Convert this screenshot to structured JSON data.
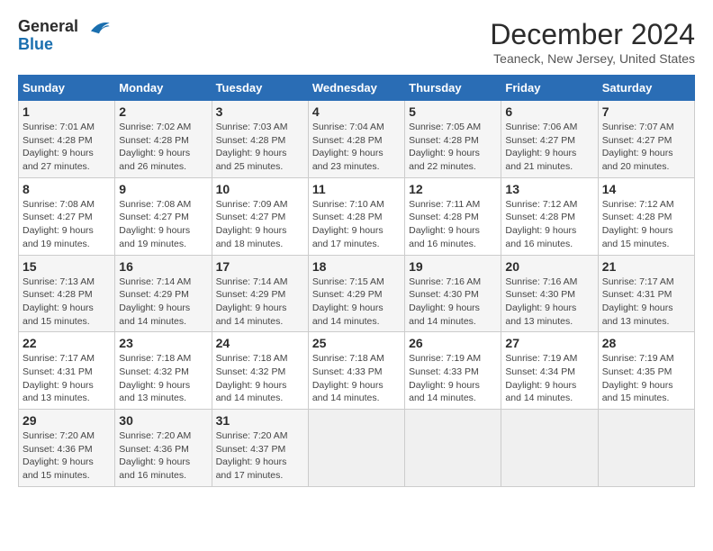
{
  "header": {
    "logo_line1": "General",
    "logo_line2": "Blue",
    "month": "December 2024",
    "location": "Teaneck, New Jersey, United States"
  },
  "days_of_week": [
    "Sunday",
    "Monday",
    "Tuesday",
    "Wednesday",
    "Thursday",
    "Friday",
    "Saturday"
  ],
  "weeks": [
    [
      {
        "day": "1",
        "info": "Sunrise: 7:01 AM\nSunset: 4:28 PM\nDaylight: 9 hours\nand 27 minutes."
      },
      {
        "day": "2",
        "info": "Sunrise: 7:02 AM\nSunset: 4:28 PM\nDaylight: 9 hours\nand 26 minutes."
      },
      {
        "day": "3",
        "info": "Sunrise: 7:03 AM\nSunset: 4:28 PM\nDaylight: 9 hours\nand 25 minutes."
      },
      {
        "day": "4",
        "info": "Sunrise: 7:04 AM\nSunset: 4:28 PM\nDaylight: 9 hours\nand 23 minutes."
      },
      {
        "day": "5",
        "info": "Sunrise: 7:05 AM\nSunset: 4:28 PM\nDaylight: 9 hours\nand 22 minutes."
      },
      {
        "day": "6",
        "info": "Sunrise: 7:06 AM\nSunset: 4:27 PM\nDaylight: 9 hours\nand 21 minutes."
      },
      {
        "day": "7",
        "info": "Sunrise: 7:07 AM\nSunset: 4:27 PM\nDaylight: 9 hours\nand 20 minutes."
      }
    ],
    [
      {
        "day": "8",
        "info": "Sunrise: 7:08 AM\nSunset: 4:27 PM\nDaylight: 9 hours\nand 19 minutes."
      },
      {
        "day": "9",
        "info": "Sunrise: 7:08 AM\nSunset: 4:27 PM\nDaylight: 9 hours\nand 19 minutes."
      },
      {
        "day": "10",
        "info": "Sunrise: 7:09 AM\nSunset: 4:27 PM\nDaylight: 9 hours\nand 18 minutes."
      },
      {
        "day": "11",
        "info": "Sunrise: 7:10 AM\nSunset: 4:28 PM\nDaylight: 9 hours\nand 17 minutes."
      },
      {
        "day": "12",
        "info": "Sunrise: 7:11 AM\nSunset: 4:28 PM\nDaylight: 9 hours\nand 16 minutes."
      },
      {
        "day": "13",
        "info": "Sunrise: 7:12 AM\nSunset: 4:28 PM\nDaylight: 9 hours\nand 16 minutes."
      },
      {
        "day": "14",
        "info": "Sunrise: 7:12 AM\nSunset: 4:28 PM\nDaylight: 9 hours\nand 15 minutes."
      }
    ],
    [
      {
        "day": "15",
        "info": "Sunrise: 7:13 AM\nSunset: 4:28 PM\nDaylight: 9 hours\nand 15 minutes."
      },
      {
        "day": "16",
        "info": "Sunrise: 7:14 AM\nSunset: 4:29 PM\nDaylight: 9 hours\nand 14 minutes."
      },
      {
        "day": "17",
        "info": "Sunrise: 7:14 AM\nSunset: 4:29 PM\nDaylight: 9 hours\nand 14 minutes."
      },
      {
        "day": "18",
        "info": "Sunrise: 7:15 AM\nSunset: 4:29 PM\nDaylight: 9 hours\nand 14 minutes."
      },
      {
        "day": "19",
        "info": "Sunrise: 7:16 AM\nSunset: 4:30 PM\nDaylight: 9 hours\nand 14 minutes."
      },
      {
        "day": "20",
        "info": "Sunrise: 7:16 AM\nSunset: 4:30 PM\nDaylight: 9 hours\nand 13 minutes."
      },
      {
        "day": "21",
        "info": "Sunrise: 7:17 AM\nSunset: 4:31 PM\nDaylight: 9 hours\nand 13 minutes."
      }
    ],
    [
      {
        "day": "22",
        "info": "Sunrise: 7:17 AM\nSunset: 4:31 PM\nDaylight: 9 hours\nand 13 minutes."
      },
      {
        "day": "23",
        "info": "Sunrise: 7:18 AM\nSunset: 4:32 PM\nDaylight: 9 hours\nand 13 minutes."
      },
      {
        "day": "24",
        "info": "Sunrise: 7:18 AM\nSunset: 4:32 PM\nDaylight: 9 hours\nand 14 minutes."
      },
      {
        "day": "25",
        "info": "Sunrise: 7:18 AM\nSunset: 4:33 PM\nDaylight: 9 hours\nand 14 minutes."
      },
      {
        "day": "26",
        "info": "Sunrise: 7:19 AM\nSunset: 4:33 PM\nDaylight: 9 hours\nand 14 minutes."
      },
      {
        "day": "27",
        "info": "Sunrise: 7:19 AM\nSunset: 4:34 PM\nDaylight: 9 hours\nand 14 minutes."
      },
      {
        "day": "28",
        "info": "Sunrise: 7:19 AM\nSunset: 4:35 PM\nDaylight: 9 hours\nand 15 minutes."
      }
    ],
    [
      {
        "day": "29",
        "info": "Sunrise: 7:20 AM\nSunset: 4:36 PM\nDaylight: 9 hours\nand 15 minutes."
      },
      {
        "day": "30",
        "info": "Sunrise: 7:20 AM\nSunset: 4:36 PM\nDaylight: 9 hours\nand 16 minutes."
      },
      {
        "day": "31",
        "info": "Sunrise: 7:20 AM\nSunset: 4:37 PM\nDaylight: 9 hours\nand 17 minutes."
      },
      {
        "day": "",
        "info": ""
      },
      {
        "day": "",
        "info": ""
      },
      {
        "day": "",
        "info": ""
      },
      {
        "day": "",
        "info": ""
      }
    ]
  ]
}
